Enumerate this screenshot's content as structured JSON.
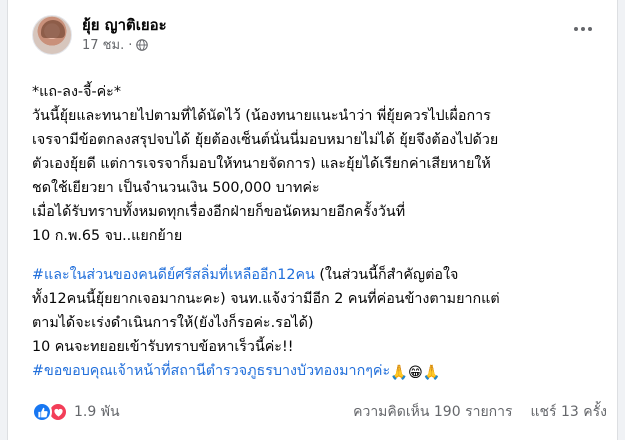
{
  "post": {
    "author": "ยุ้ย ญาติเยอะ",
    "time": "17 ชม.",
    "separator": "·",
    "lines": [
      "*แถ-ลง-จี้-ค่ะ*",
      "วันนี้ยุ้ยและทนายไปตามที่ได้นัดไว้ (น้องทนายแนะนำว่า  พี่ยุ้ยควรไปเผื่อการ",
      "เจรจามีข้อตกลงสรุปจบได้ ยุ้ยต้องเซ็นต์นั่นนี่มอบหมายไม่ได้ ยุ้ยจึงต้องไปด้วย",
      "ตัวเองยุ้ยดี แต่การเจรจาก็มอบให้ทนายจัดการ) และยุ้ยได้เรียกค่าเสียหายให้",
      "ชดใช้เยียวยา เป็นจำนวนเงิน 500,000 บาทค่ะ",
      "เมื่อได้รับทราบทั้งหมดทุกเรื่องอีกฝ่ายก็ขอนัดหมายอีกครั้งวันที่",
      "10 ก.พ.65 จบ..แยกย้าย"
    ],
    "para2_line1_tag": "#และในส่วนของคนดีย์ศรีสลิ่มที่เหลืออีก12คน",
    "para2_line1_rest": " (ในส่วนนี้ก็สำคัญต่อใจ",
    "para2_line2": "ทั้ง12คนนี้ยุ้ยยากเจอมากนะคะ) จนท.แจ้งว่ามีอีก 2 คนที่ค่อนข้างตามยากแต่",
    "para2_line3": "ตามได้จะเร่งดำเนินการให้(ยังไงก็รอค่ะ.รอได้)",
    "para2_line4": "10 คนจะทยอยเข้ารับทราบข้อหาเร็วนี้ค่ะ!!",
    "para2_line5_tag": "#ขอขอบคุณเจ้าหน้าที่สถานีตำรวจภูธรบางบัวทองมากๆค่ะ",
    "para2_line5_emoji": " 🙏😁🙏"
  },
  "footer": {
    "reaction_count": "1.9 พัน",
    "comments": "ความคิดเห็น 190 รายการ",
    "shares": "แชร์ 13 ครั้ง"
  },
  "colors": {
    "link": "#216fdb",
    "like": "#1877f2",
    "love": "#f33e58"
  },
  "icons": [
    "globe-icon",
    "more-options-icon",
    "like-reaction-icon",
    "love-reaction-icon"
  ]
}
